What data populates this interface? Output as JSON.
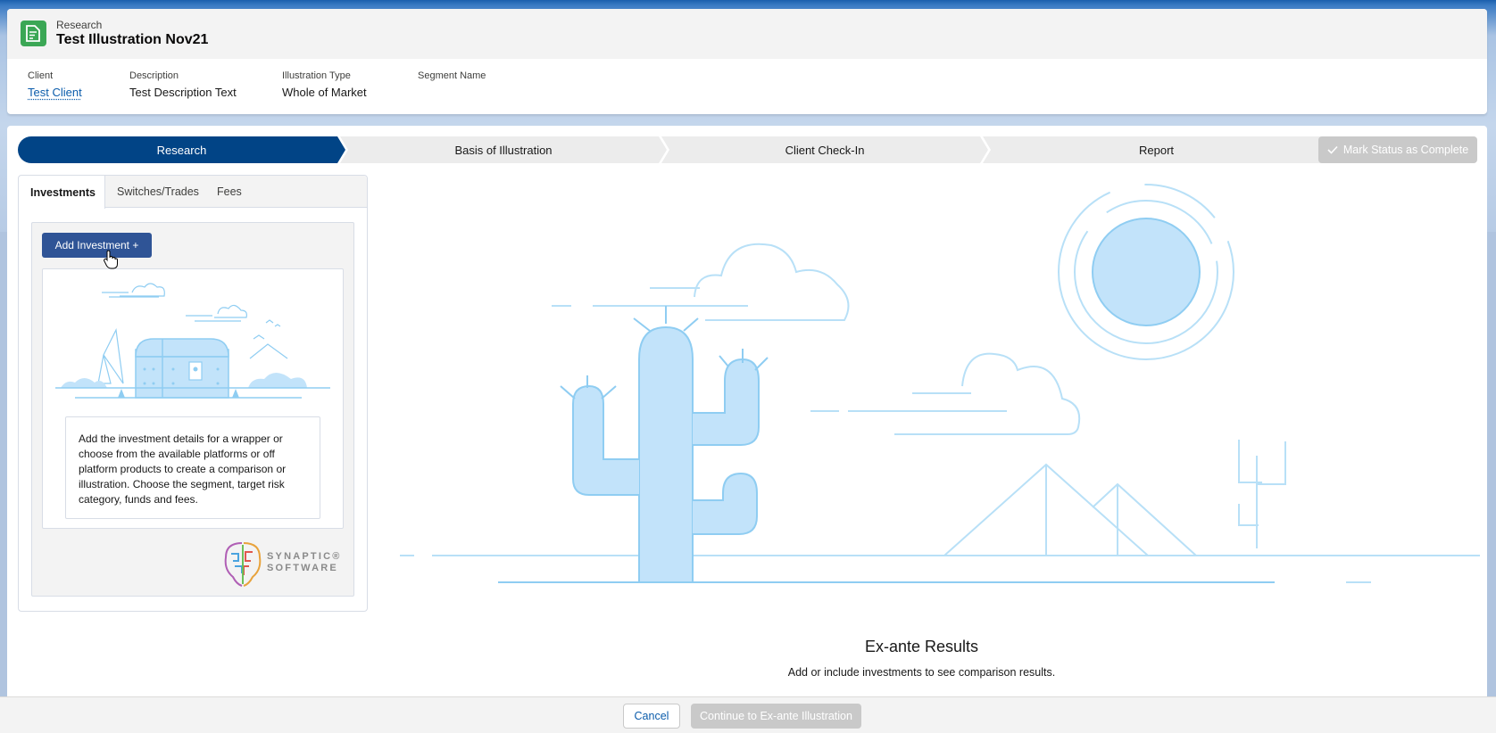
{
  "record": {
    "object_label": "Research",
    "title": "Test Illustration Nov21",
    "icon": "record-icon"
  },
  "fields": [
    {
      "label": "Client",
      "value": "Test Client"
    },
    {
      "label": "Description",
      "value": "Test Description Text"
    },
    {
      "label": "Illustration Type",
      "value": "Whole of Market"
    },
    {
      "label": "Segment Name",
      "value": ""
    }
  ],
  "path": {
    "stages": [
      "Research",
      "Basis of Illustration",
      "Client Check-In",
      "Report"
    ],
    "active_stage": "Research",
    "mark_complete_label": "Mark Status as Complete"
  },
  "tabs": [
    "Investments",
    "Switches/Trades",
    "Fees"
  ],
  "investments": {
    "add_button_label": "Add Investment +",
    "description": "Add the investment details for a wrapper or choose from the available platforms or off platform products to create a comparison or illustration. Choose the segment, target risk category, funds and fees.",
    "brand_line1": "SYNAPTIC®",
    "brand_line2": "SOFTWARE"
  },
  "results": {
    "title": "Ex-ante Results",
    "subtitle": "Add or include investments to see comparison results."
  },
  "footer": {
    "cancel_label": "Cancel",
    "continue_label": "Continue to Ex-ante Illustration"
  },
  "colors": {
    "brand_dark_blue": "#014486",
    "button_blue": "#2f5496",
    "record_icon_green": "#3ba755",
    "illustration_fill": "#c2e3fa",
    "illustration_stroke": "#8fcdf2"
  }
}
